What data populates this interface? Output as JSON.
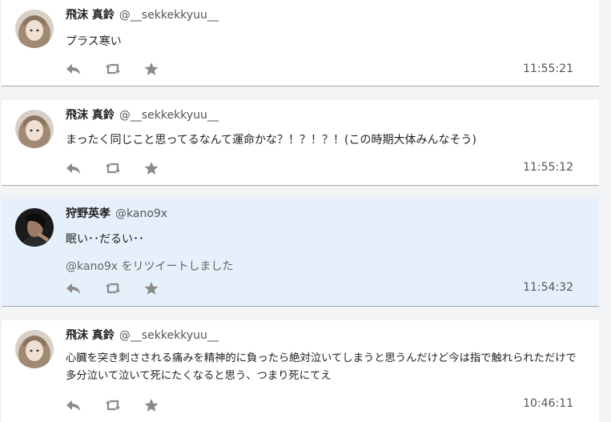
{
  "tweets": [
    {
      "name": "飛沫 真鈴",
      "handle": "@__sekkekkyuu__",
      "text": "プラス寒い",
      "time": "11:55:21",
      "highlighted": false
    },
    {
      "name": "飛沫 真鈴",
      "handle": "@__sekkekkyuu__",
      "text": "まったく同じこと思ってるなんて運命かな？！？！？！(この時期大体みんなそう)",
      "time": "11:55:12",
      "highlighted": false
    },
    {
      "name": "狩野英孝",
      "handle": "@kano9x",
      "text": "眠い･･だるい･･",
      "retweet_user": "@kano9x",
      "retweet_suffix": " をリツイートしました",
      "time": "11:54:32",
      "highlighted": true
    },
    {
      "name": "飛沫 真鈴",
      "handle": "@__sekkekkyuu__",
      "text": "心臓を突き刺さされる痛みを精神的に負ったら絶対泣いてしまうと思うんだけど今は指で触れられただけで多分泣いて泣いて死にたくなると思う、つまり死にてえ",
      "time": "10:46:11",
      "highlighted": false
    }
  ],
  "icons": {
    "reply": "reply-icon",
    "retweet": "retweet-icon",
    "favorite": "star-icon"
  },
  "colors": {
    "highlight_bg": "#e6f0fb",
    "icon": "#8a8a8a"
  }
}
